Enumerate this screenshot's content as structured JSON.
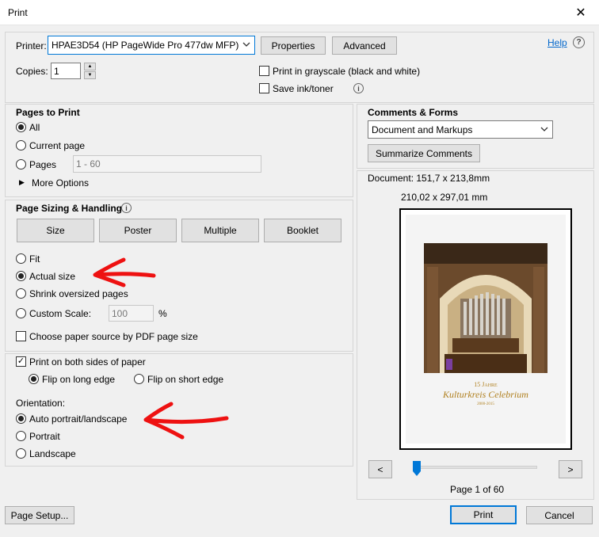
{
  "window": {
    "title": "Print"
  },
  "printer": {
    "label": "Printer:",
    "selected": "HPAE3D54 (HP PageWide Pro 477dw MFP)",
    "properties_label": "Properties",
    "advanced_label": "Advanced",
    "help_label": "Help"
  },
  "copies": {
    "label": "Copies:",
    "value": "1"
  },
  "options": {
    "grayscale_label": "Print in grayscale (black and white)",
    "grayscale_checked": false,
    "save_ink_label": "Save ink/toner",
    "save_ink_checked": false
  },
  "pages_to_print": {
    "heading": "Pages to Print",
    "all_label": "All",
    "current_label": "Current page",
    "pages_label": "Pages",
    "pages_value": "1 - 60",
    "more_options_label": "More Options",
    "selected": "all"
  },
  "sizing": {
    "heading": "Page Sizing & Handling",
    "tabs": [
      "Size",
      "Poster",
      "Multiple",
      "Booklet"
    ],
    "fit_label": "Fit",
    "actual_label": "Actual size",
    "shrink_label": "Shrink oversized pages",
    "custom_label": "Custom Scale:",
    "custom_value": "100",
    "percent": "%",
    "paper_source_label": "Choose paper source by PDF page size",
    "selected": "actual"
  },
  "duplex": {
    "both_sides_label": "Print on both sides of paper",
    "both_sides_checked": true,
    "long_edge_label": "Flip on long edge",
    "short_edge_label": "Flip on short edge",
    "selected": "long"
  },
  "orientation": {
    "heading": "Orientation:",
    "auto_label": "Auto portrait/landscape",
    "portrait_label": "Portrait",
    "landscape_label": "Landscape",
    "selected": "auto"
  },
  "comments": {
    "heading": "Comments & Forms",
    "selected": "Document and Markups",
    "summarize_label": "Summarize Comments"
  },
  "preview": {
    "document_size": "Document: 151,7 x 213,8mm",
    "paper_size": "210,02 x 297,01 mm",
    "page_heading": "15 Jahre",
    "page_title": "Kulturkreis Celebrium",
    "page_years": "2000-2015",
    "prev_label": "<",
    "next_label": ">",
    "page_indicator": "Page 1 of 60",
    "slider_position": 0.0
  },
  "footer": {
    "page_setup_label": "Page Setup...",
    "print_label": "Print",
    "cancel_label": "Cancel"
  },
  "colors": {
    "accent": "#0078d7",
    "annotation": "#ee1111"
  }
}
